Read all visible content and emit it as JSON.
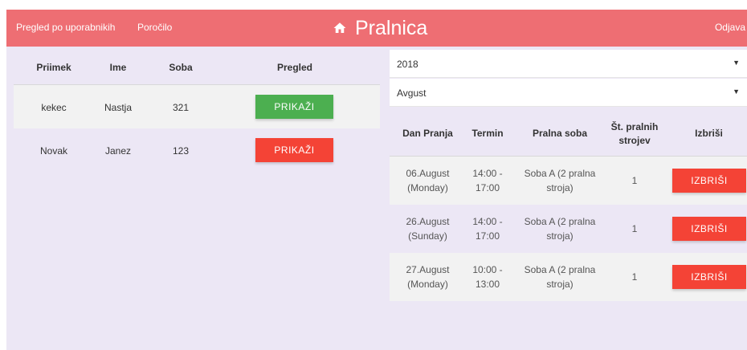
{
  "nav": {
    "link_users": "Pregled po uporabnikih",
    "link_report": "Poročilo",
    "title": "Pralnica",
    "logout": "Odjava",
    "home_icon": "home-icon",
    "color": "#ee6e73"
  },
  "users_table": {
    "headers": [
      "Priimek",
      "Ime",
      "Soba",
      "Pregled"
    ],
    "rows": [
      {
        "priimek": "kekec",
        "ime": "Nastja",
        "soba": "321",
        "button": "PRIKAŽI",
        "button_color": "#4caf50"
      },
      {
        "priimek": "Novak",
        "ime": "Janez",
        "soba": "123",
        "button": "PRIKAŽI",
        "button_color": "#f44336"
      }
    ]
  },
  "filters": {
    "year": "2018",
    "month": "Avgust"
  },
  "bookings_table": {
    "headers": [
      "Dan Pranja",
      "Termin",
      "Pralna soba",
      "Št. pralnih strojev",
      "Izbriši"
    ],
    "header_st_line1": "Št. pralnih",
    "header_st_line2": "strojev",
    "rows": [
      {
        "dan_1": "06.August",
        "dan_2": "(Monday)",
        "termin_1": "14:00 -",
        "termin_2": "17:00",
        "soba_1": "Soba A (2 pralna",
        "soba_2": "stroja)",
        "st": "1",
        "button": "IZBRIŠI"
      },
      {
        "dan_1": "26.August",
        "dan_2": "(Sunday)",
        "termin_1": "14:00 -",
        "termin_2": "17:00",
        "soba_1": "Soba A (2 pralna",
        "soba_2": "stroja)",
        "st": "1",
        "button": "IZBRIŠI"
      },
      {
        "dan_1": "27.August",
        "dan_2": "(Monday)",
        "termin_1": "10:00 -",
        "termin_2": "13:00",
        "soba_1": "Soba A (2 pralna",
        "soba_2": "stroja)",
        "st": "1",
        "button": "IZBRIŠI"
      }
    ]
  },
  "colors": {
    "background": "#ece7f5",
    "green": "#4caf50",
    "red": "#f44336"
  }
}
